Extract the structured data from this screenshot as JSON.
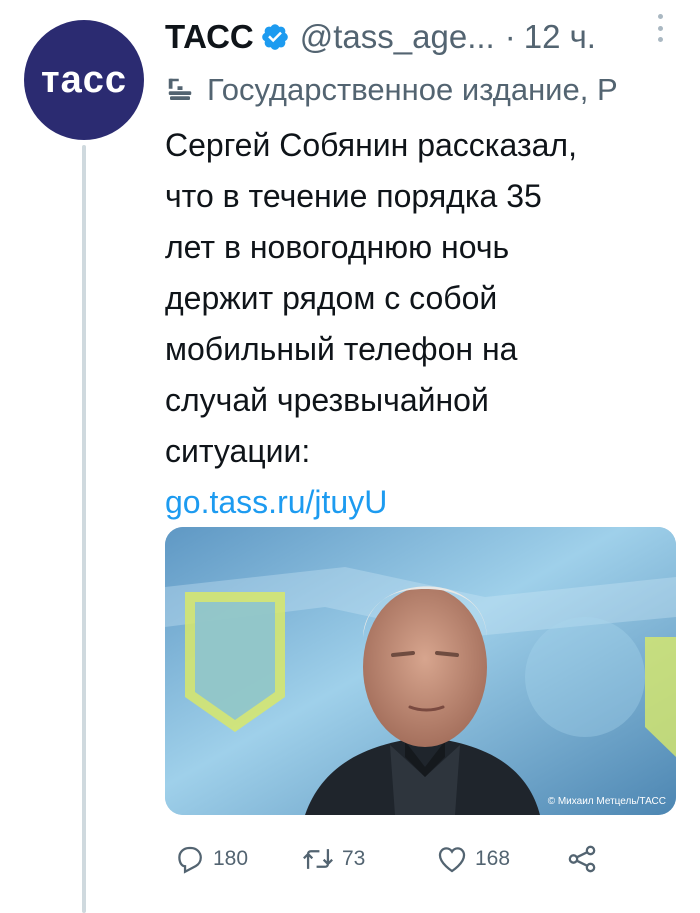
{
  "author": {
    "avatar_text": "тасс",
    "name": "ТАСС",
    "handle": "@tass_age...",
    "separator": "·",
    "time": "12 ч.",
    "label": "Государственное издание, Р"
  },
  "tweet": {
    "lines": [
      "Сергей Собянин рассказал,",
      "что в течение порядка 35",
      "лет в новогоднюю ночь",
      "держит рядом с собой",
      "мобильный телефон на",
      "случай чрезвычайной",
      "ситуации:"
    ],
    "link": "go.tass.ru/jtuyU"
  },
  "media": {
    "description": "Фото: Сергей Собянин",
    "credit": "© Михаил Метцель/ТАСС"
  },
  "actions": {
    "replies": "180",
    "retweets": "73",
    "likes": "168"
  },
  "colors": {
    "avatar_bg": "#2b2b71",
    "link": "#1d9bf0",
    "verified": "#1d9bf0",
    "muted": "#536471"
  },
  "icons": {
    "verified": "verified-badge-icon",
    "label": "government-building-icon",
    "more": "more-vertical-icon",
    "reply": "reply-icon",
    "retweet": "retweet-icon",
    "like": "heart-icon",
    "share": "share-icon"
  }
}
